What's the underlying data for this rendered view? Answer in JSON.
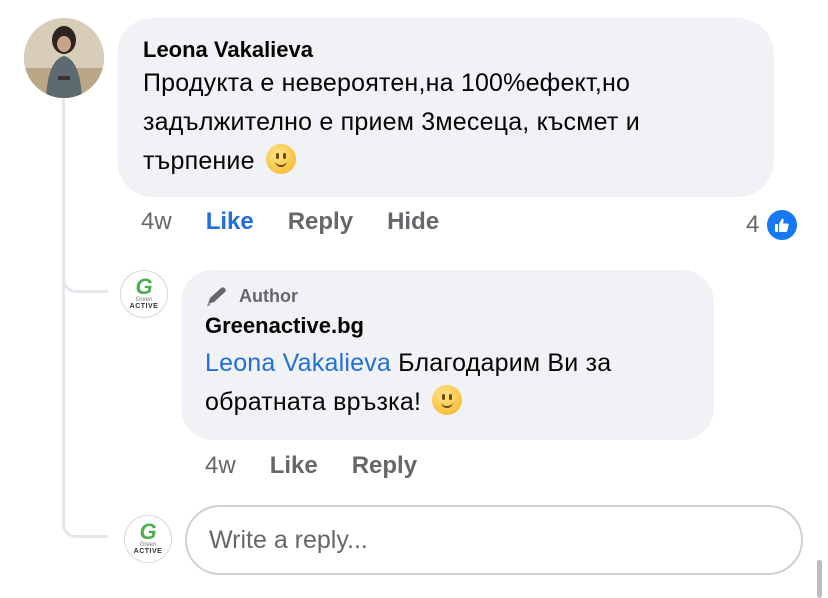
{
  "comment": {
    "author": "Leona Vakalieva",
    "line1": "Продукта е невероятен,на 100%ефект,но",
    "line2": "задължително е прием 3месеца, късмет и",
    "line3": "търпение",
    "time": "4w",
    "like_label": "Like",
    "reply_label": "Reply",
    "hide_label": "Hide",
    "like_count": "4"
  },
  "reply": {
    "badge": "Author",
    "author": "Greenactive.bg",
    "mention": "Leona Vakalieva",
    "text_part1": "Благодарим Ви за",
    "text_part2": "обратната връзка!",
    "time": "4w",
    "like_label": "Like",
    "reply_label": "Reply"
  },
  "logo": {
    "letter": "G",
    "sub": "Green",
    "word": "ACTIVE"
  },
  "composer": {
    "placeholder": "Write a reply..."
  },
  "colors": {
    "accent": "#216fdb",
    "bubble": "#f0f2f5",
    "muted": "#65676b",
    "like_blue": "#1877f2"
  }
}
